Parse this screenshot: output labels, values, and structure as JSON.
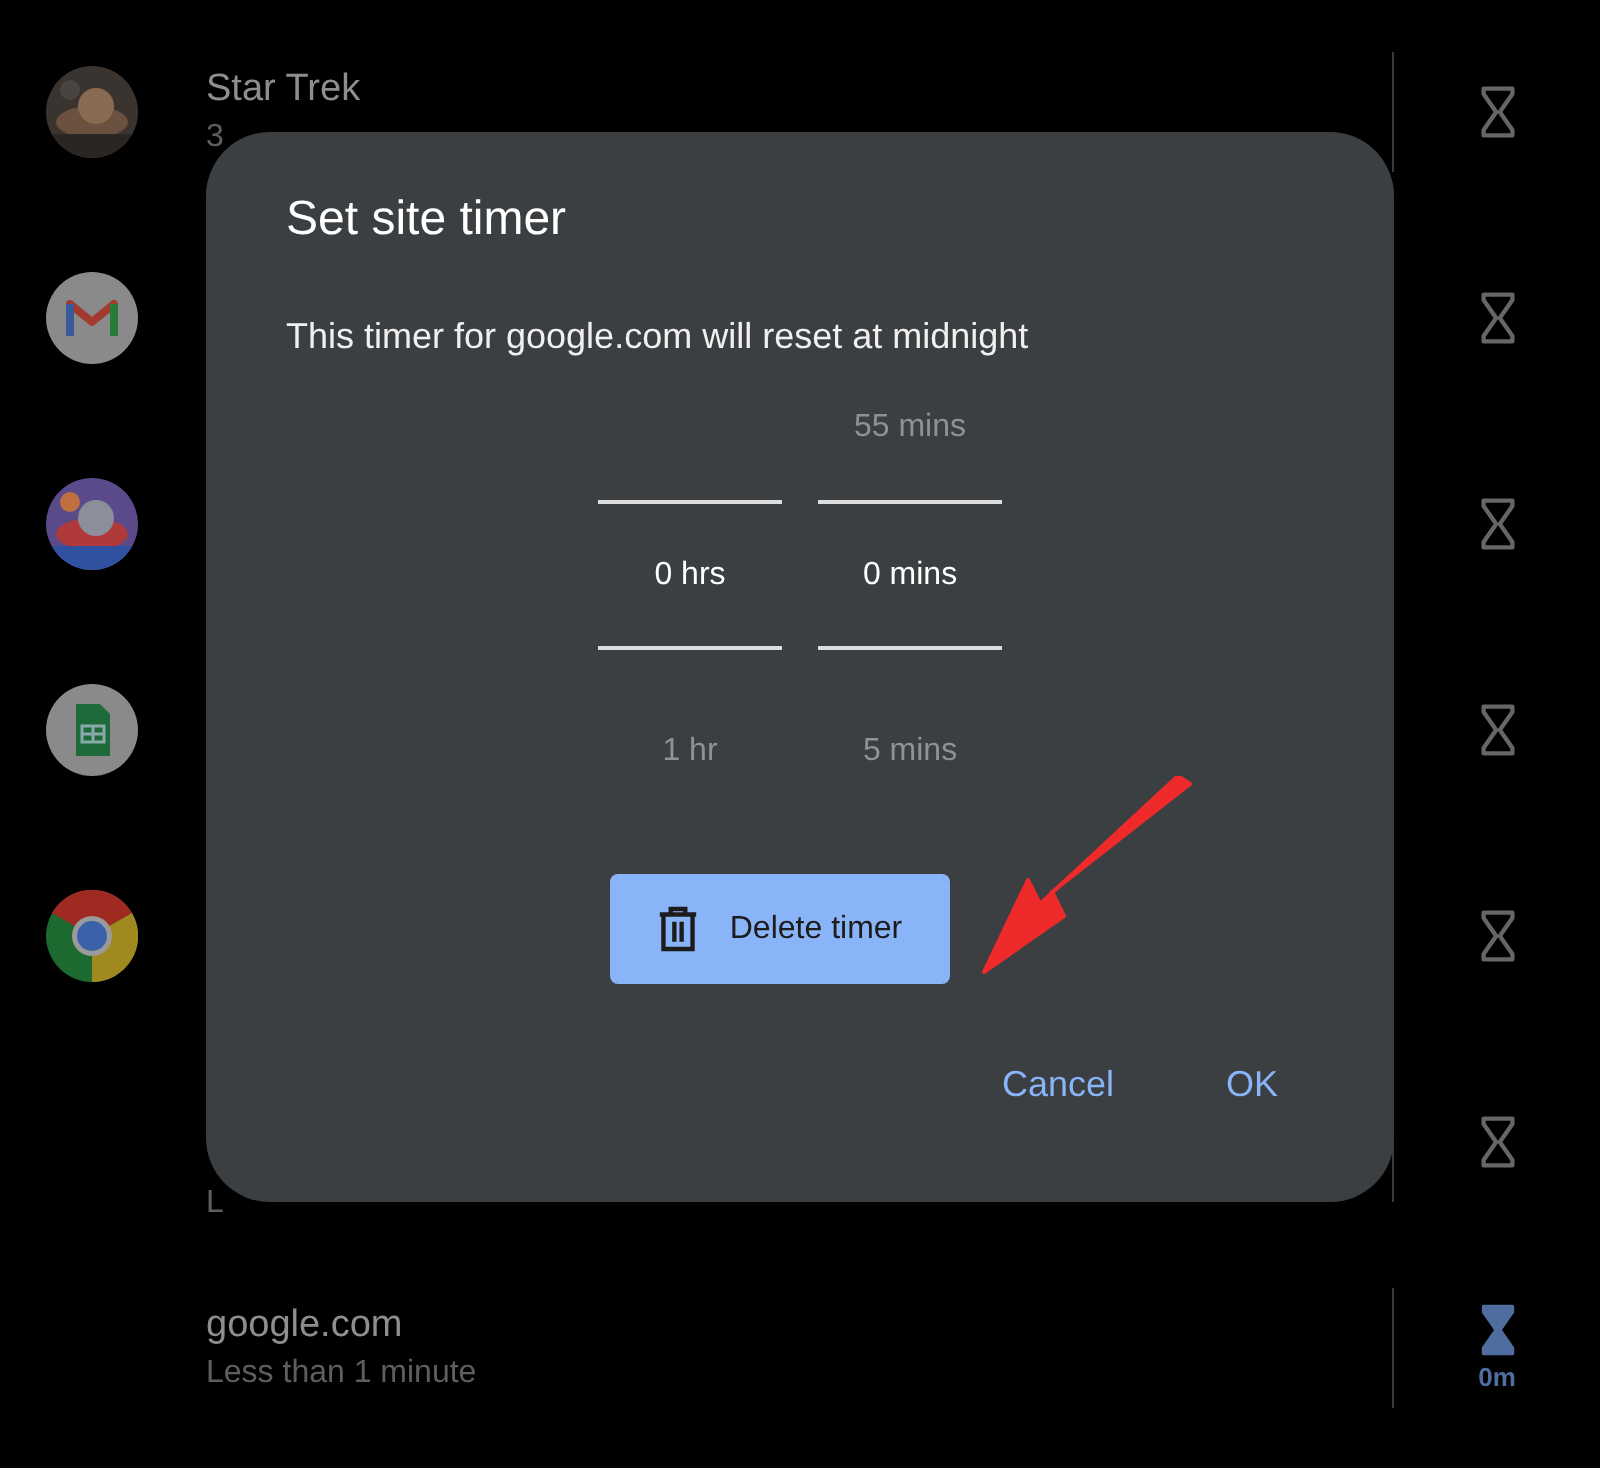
{
  "sites": [
    {
      "kind": "picture",
      "title": "Star Trek",
      "subtitle": "3",
      "timer_set": false
    },
    {
      "kind": "mail",
      "timer_set": false
    },
    {
      "kind": "picture",
      "timer_set": false
    },
    {
      "kind": "sheet",
      "timer_set": false
    },
    {
      "kind": "browser",
      "timer_set": false
    },
    {
      "subtitle": "L",
      "timer_set": false
    },
    {
      "title": "google.com",
      "subtitle": "Less than 1 minute",
      "timer_set": true,
      "timer_label": "0m"
    }
  ],
  "dialog": {
    "title": "Set site timer",
    "message": "This timer for google.com will reset at midnight",
    "picker": [
      {
        "selected": "0 hrs",
        "below": "1 hr"
      },
      {
        "above": "55 mins",
        "selected": "0 mins",
        "below": "5 mins"
      }
    ],
    "delete_button": "Delete timer",
    "buttons": [
      "Cancel",
      "OK"
    ]
  }
}
